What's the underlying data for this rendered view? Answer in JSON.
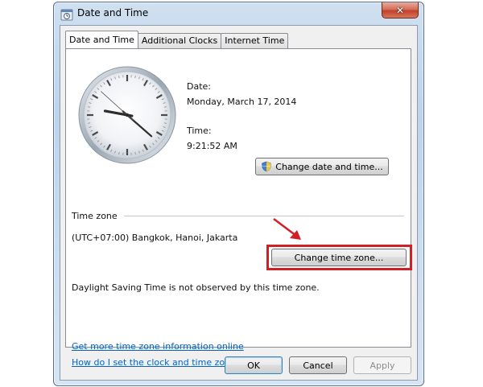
{
  "window": {
    "title": "Date and Time",
    "close_glyph": "✕"
  },
  "tabs": [
    {
      "label": "Date and Time",
      "active": true
    },
    {
      "label": "Additional Clocks",
      "active": false
    },
    {
      "label": "Internet Time",
      "active": false
    }
  ],
  "date": {
    "label": "Date:",
    "value": "Monday, March 17, 2014"
  },
  "time": {
    "label": "Time:",
    "value": "9:21:52 AM"
  },
  "clock": {
    "hour": 9,
    "minute": 21,
    "second": 52
  },
  "buttons": {
    "change_date_time": "Change date and time...",
    "change_time_zone": "Change time zone...",
    "ok": "OK",
    "cancel": "Cancel",
    "apply": "Apply"
  },
  "time_zone": {
    "heading": "Time zone",
    "value": "(UTC+07:00) Bangkok, Hanoi, Jakarta",
    "dst_note": "Daylight Saving Time is not observed by this time zone."
  },
  "links": {
    "more_info": "Get more time zone information online",
    "how_to_set": "How do I set the clock and time zone?"
  },
  "colors": {
    "highlight": "#d21f26",
    "link": "#0066cc",
    "accent": "#3c7fb1"
  },
  "icons": [
    "clock-app-icon",
    "close-icon",
    "uac-shield-icon",
    "annotation-arrow-icon"
  ]
}
